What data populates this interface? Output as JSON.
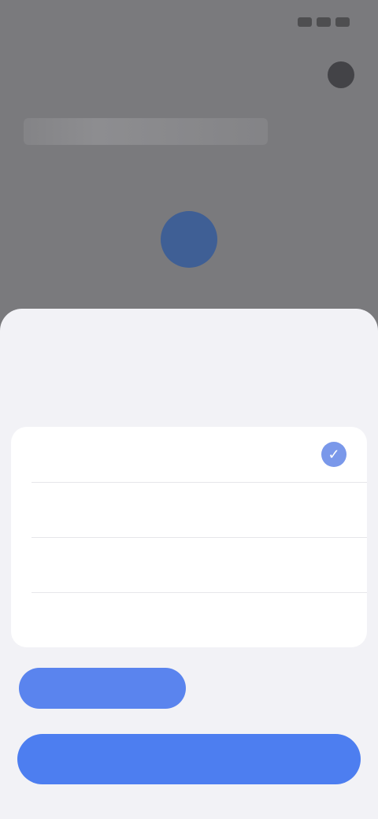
{
  "status_bar": {
    "time": ""
  },
  "background": {
    "header_title": "",
    "subtitle": ""
  },
  "sheet": {
    "title": "",
    "close_label": "",
    "section_label": "",
    "options": [
      {
        "label": "",
        "selected": true
      },
      {
        "label": "",
        "selected": false
      },
      {
        "label": "",
        "selected": false
      },
      {
        "label": "",
        "selected": false
      }
    ],
    "secondary_button_label": "",
    "text_button_label": "",
    "primary_button_label": ""
  },
  "colors": {
    "accent": "#4d7ef0",
    "accent_light": "#7a98ea",
    "sheet_background": "#f2f2f6",
    "card_background": "#ffffff",
    "scrim": "#7a7a7d"
  },
  "icons": {
    "header_action": "profile-icon",
    "fab": "action-icon",
    "selected_option": "checkmark-icon"
  }
}
